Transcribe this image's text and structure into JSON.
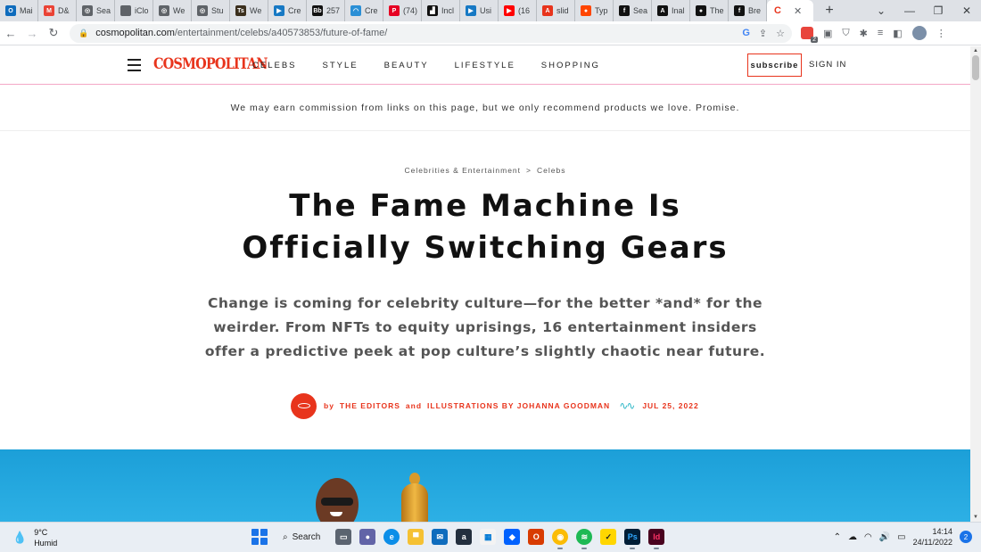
{
  "browser": {
    "tabs": [
      {
        "label": "Mai",
        "icon": "outlook-icon",
        "color": "#0f6cbd",
        "glyph": "O"
      },
      {
        "label": "D&",
        "icon": "gmail-icon",
        "color": "#ea4335",
        "glyph": "M"
      },
      {
        "label": "Sea",
        "icon": "globe-icon",
        "color": "#5f6368",
        "glyph": "◎"
      },
      {
        "label": "iClo",
        "icon": "apple-icon",
        "color": "#5f6368",
        "glyph": ""
      },
      {
        "label": "We",
        "icon": "globe-icon",
        "color": "#5f6368",
        "glyph": "◎"
      },
      {
        "label": "Stu",
        "icon": "globe-icon",
        "color": "#5f6368",
        "glyph": "◎"
      },
      {
        "label": "We",
        "icon": "ts-icon",
        "color": "#3b2f1d",
        "glyph": "Ts"
      },
      {
        "label": "Cre",
        "icon": "video-icon",
        "color": "#1779c4",
        "glyph": "▶"
      },
      {
        "label": "257",
        "icon": "bb-icon",
        "color": "#111111",
        "glyph": "Bb"
      },
      {
        "label": "Cre",
        "icon": "cloud-icon",
        "color": "#2a8fd6",
        "glyph": "◠"
      },
      {
        "label": "(74)",
        "icon": "pinterest-icon",
        "color": "#e60023",
        "glyph": "P"
      },
      {
        "label": "Incl",
        "icon": "incl-icon",
        "color": "#111111",
        "glyph": "▟"
      },
      {
        "label": "Usi",
        "icon": "video-icon",
        "color": "#1779c4",
        "glyph": "▶"
      },
      {
        "label": "(16",
        "icon": "youtube-icon",
        "color": "#ff0000",
        "glyph": "▶"
      },
      {
        "label": "slid",
        "icon": "adobe-icon",
        "color": "#e8341c",
        "glyph": "A"
      },
      {
        "label": "Typ",
        "icon": "reddit-icon",
        "color": "#ff4500",
        "glyph": "●"
      },
      {
        "label": "Sea",
        "icon": "f-icon",
        "color": "#111111",
        "glyph": "f"
      },
      {
        "label": "Inal",
        "icon": "a-icon",
        "color": "#111111",
        "glyph": "A"
      },
      {
        "label": "The",
        "icon": "circle-icon",
        "color": "#111111",
        "glyph": "●"
      },
      {
        "label": "Bre",
        "icon": "f-icon",
        "color": "#111111",
        "glyph": "f"
      }
    ],
    "active_tab_glyph": "C",
    "active_tab_close": "✕",
    "new_tab": "+",
    "url_host": "cosmopolitan.com",
    "url_path": "/entertainment/celebs/a40573853/future-of-fame/",
    "extension_badge": "2"
  },
  "site": {
    "logo": "COSMOPOLITAN",
    "nav": [
      "CELEBS",
      "STYLE",
      "BEAUTY",
      "LIFESTYLE",
      "SHOPPING"
    ],
    "subscribe": "subscribe",
    "signin": "SIGN IN",
    "disclaimer": "We may earn commission from links on this page, but we only recommend products we love. Promise."
  },
  "article": {
    "breadcrumb": [
      "Celebrities & Entertainment",
      "Celebs"
    ],
    "breadcrumb_sep": ">",
    "headline": "The Fame Machine Is Officially Switching Gears",
    "dek": "Change is coming for celebrity culture—for the better *and* for the weirder. From NFTs to equity uprisings, 16 entertainment insiders offer a predictive peek at pop culture’s slightly chaotic near future.",
    "byline_by": "by",
    "byline_author": "THE EDITORS",
    "byline_and": "and",
    "byline_illustrator": "ILLUSTRATIONS BY JOHANNA GOODMAN",
    "date": "JUL 25, 2022"
  },
  "taskbar": {
    "temp": "9°C",
    "weather": "Humid",
    "search": "Search",
    "time": "14:14",
    "date": "24/11/2022",
    "notifications": "2"
  },
  "colors": {
    "brand": "#e8341c",
    "nav_underline": "#f4a7c6",
    "hero_sky": "#2db0e5"
  }
}
